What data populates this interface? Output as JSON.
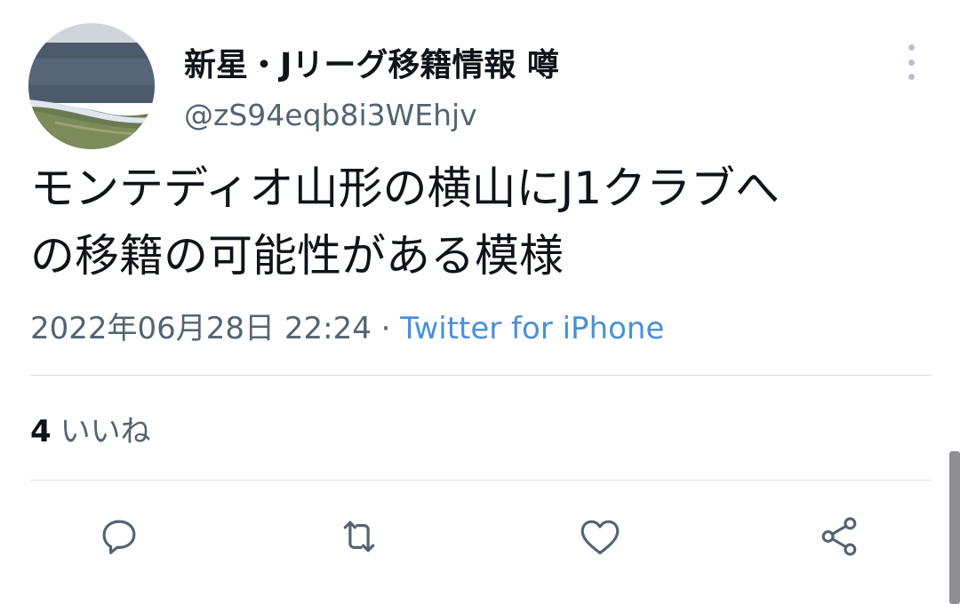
{
  "tweet": {
    "display_name": "新星・Jリーグ移籍情報 噂",
    "handle": "@zS94eqb8i3WEhjv",
    "text_line1": "モンテディオ山形の横山にJ1クラブへ",
    "text_line2": "の移籍の可能性がある模様",
    "datetime": "2022年06月28日 22:24",
    "separator": "·",
    "source": "Twitter for iPhone",
    "likes_count": "4",
    "likes_label": "いいね"
  },
  "icons": {
    "more": "more-vertical-icon",
    "reply": "reply-icon",
    "retweet": "retweet-icon",
    "like": "heart-icon",
    "share": "share-icon"
  },
  "colors": {
    "text": "#0f1419",
    "secondary": "#536471",
    "link": "#4a90d9",
    "icon": "#536471",
    "divider": "#dde2e6"
  }
}
